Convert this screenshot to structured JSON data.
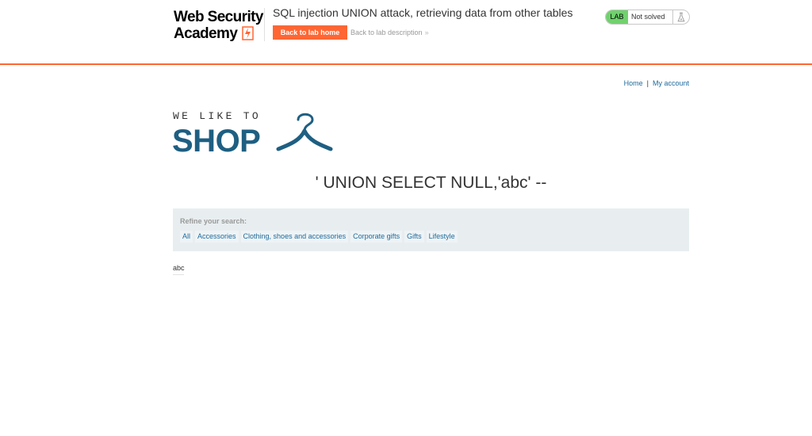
{
  "academy_header": {
    "logo_line1": "Web Security",
    "logo_line2": "Academy",
    "lab_title": "SQL injection UNION attack, retrieving data from other tables",
    "back_to_lab_home": "Back to lab home",
    "back_to_lab_description": "Back to lab description",
    "chevron": "»",
    "lab_badge": "LAB",
    "lab_status": "Not solved",
    "accent_color": "#ff6633",
    "status_color": "#70d16d"
  },
  "nav": {
    "home": "Home",
    "separator": "|",
    "my_account": "My account"
  },
  "shop_logo": {
    "tagline": "WE LIKE TO",
    "name": "SHOP",
    "icon": "hanger-icon",
    "color": "#1e5f82"
  },
  "search": {
    "heading": "' UNION SELECT NULL,'abc' --"
  },
  "filters": {
    "label": "Refine your search:",
    "items": [
      "All",
      "Accessories",
      "Clothing, shoes and accessories",
      "Corporate gifts",
      "Gifts",
      "Lifestyle"
    ]
  },
  "results": {
    "rows": [
      "abc"
    ]
  }
}
